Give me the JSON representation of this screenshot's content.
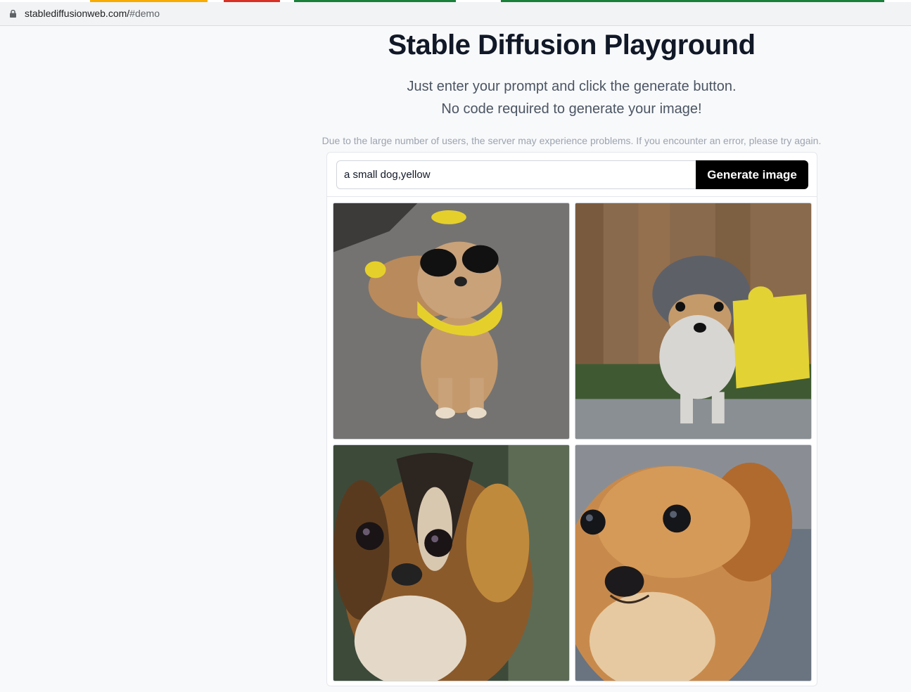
{
  "browser": {
    "url_host": "stablediffusionweb.com/",
    "url_hash": "#demo",
    "icons": {
      "lock": "lock-icon"
    }
  },
  "page": {
    "title": "Stable Diffusion Playground",
    "subtitle_line1": "Just enter your prompt and click the generate button.",
    "subtitle_line2": "No code required to generate your image!",
    "notice": "Due to the large number of users, the server may experience problems. If you encounter an error, please try again."
  },
  "generator": {
    "prompt_value": "a small dog,yellow",
    "generate_label": "Generate image",
    "results": [
      {
        "subject": "small tan dog with sunglasses and yellow knit scarf"
      },
      {
        "subject": "small grey-tan dog with yellow backpack"
      },
      {
        "subject": "close-up small tan and black dog"
      },
      {
        "subject": "close-up small ginger dog"
      }
    ]
  },
  "colors": {
    "button_bg": "#000000",
    "title": "#111827",
    "accent_yellow": "#f2dc2a"
  }
}
